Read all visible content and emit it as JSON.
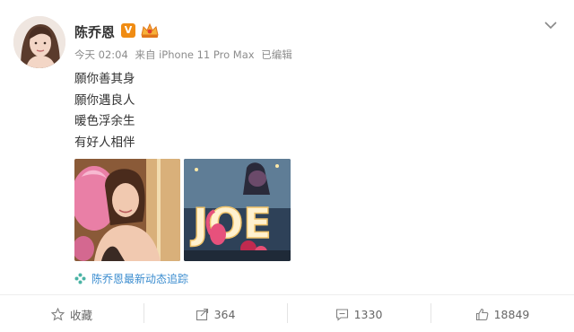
{
  "post": {
    "username": "陈乔恩",
    "vip_badge": "V",
    "time": "今天 02:04",
    "source": "来自 iPhone 11 Pro Max",
    "edited": "已编辑",
    "lines": [
      "願你善其身",
      "願你遇良人",
      "暖色浮余生",
      "有好人相伴"
    ],
    "topic": "陈乔恩最新动态追踪"
  },
  "actions": {
    "favorite_label": "收藏",
    "repost_count": "364",
    "comment_count": "1330",
    "like_count": "18849"
  },
  "photo2_text": "JOE",
  "icons": {
    "collapse": "chevron-down-icon",
    "favorite": "star-icon",
    "repost": "share-icon",
    "comment": "comment-icon",
    "like": "thumbs-up-icon",
    "topic": "pinwheel-icon"
  },
  "colors": {
    "link": "#3a8ccf",
    "vip": "#f08c13",
    "text": "#333333",
    "meta": "#8c8c8c"
  }
}
